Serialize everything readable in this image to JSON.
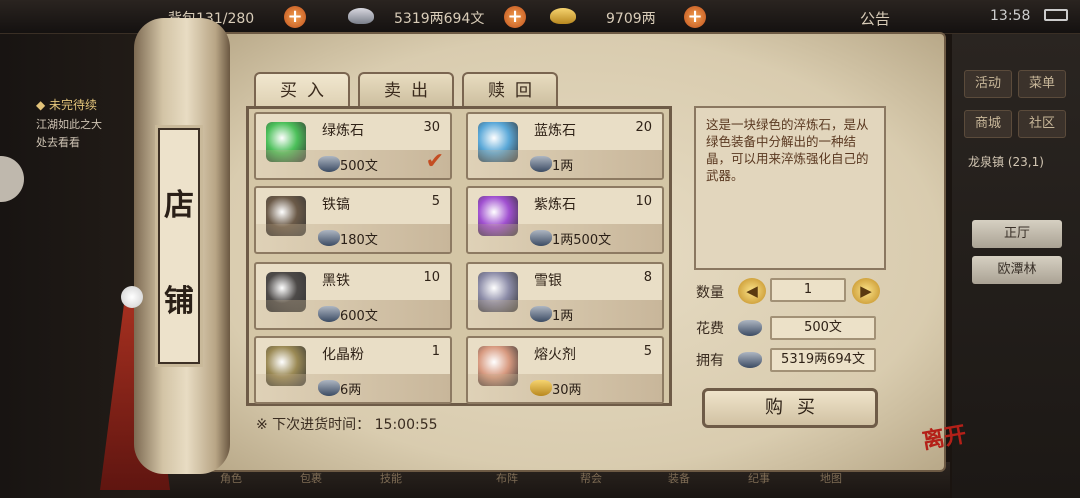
{
  "topbar": {
    "bag": "背包131/280",
    "silver": "5319两694文",
    "gold": "9709两",
    "notice": "公告",
    "time": "13:58"
  },
  "quest": {
    "title": "未完待续",
    "lines": [
      "江湖如此之大",
      "处去看看"
    ]
  },
  "right": {
    "buttons": [
      "活动",
      "菜单",
      "商城",
      "社区"
    ],
    "location": "龙泉镇 (23,1)",
    "npcs": [
      "正厅",
      "欧潭林"
    ]
  },
  "sign": [
    "店",
    "铺"
  ],
  "tabs": [
    "买入",
    "卖出",
    "赎回"
  ],
  "items": [
    {
      "name": "绿炼石",
      "qty": "30",
      "price": "500文",
      "icon": "green-gem",
      "color": "#4cc05a",
      "coin": "silver",
      "checked": true
    },
    {
      "name": "蓝炼石",
      "qty": "20",
      "price": "1两",
      "icon": "blue-gem",
      "color": "#5aa8d8",
      "coin": "silver",
      "checked": false
    },
    {
      "name": "铁镐",
      "qty": "5",
      "price": "180文",
      "icon": "pickaxe",
      "color": "#6b5a48",
      "coin": "silver",
      "checked": false
    },
    {
      "name": "紫炼石",
      "qty": "10",
      "price": "1两500文",
      "icon": "purple-gem",
      "color": "#a050d0",
      "coin": "silver",
      "checked": false
    },
    {
      "name": "黑铁",
      "qty": "10",
      "price": "600文",
      "icon": "black-iron",
      "color": "#4d4a48",
      "coin": "silver",
      "checked": false
    },
    {
      "name": "雪银",
      "qty": "8",
      "price": "1两",
      "icon": "snow-silver",
      "color": "#8c8ca8",
      "coin": "silver",
      "checked": false
    },
    {
      "name": "化晶粉",
      "qty": "1",
      "price": "6两",
      "icon": "crystal-powder",
      "color": "#9b8a55",
      "coin": "silver",
      "checked": false
    },
    {
      "name": "熔火剂",
      "qty": "5",
      "price": "30两",
      "icon": "flux-potion",
      "color": "#d89a80",
      "coin": "gold",
      "checked": false
    }
  ],
  "restock": "※ 下次进货时间：  15:00:55",
  "detail": {
    "desc": "这是一块绿色的淬炼石，是从绿色装备中分解出的一种结晶，可以用来淬炼强化自己的武器。",
    "qty_label": "数量",
    "qty_value": "1",
    "cost_label": "花费",
    "cost_value": "500文",
    "own_label": "拥有",
    "own_value": "5319两694文",
    "buy": "购买"
  },
  "leave": "离开",
  "bottom": [
    "角色",
    "包裹",
    "技能",
    "布阵",
    "帮会",
    "装备",
    "纪事",
    "地图"
  ]
}
